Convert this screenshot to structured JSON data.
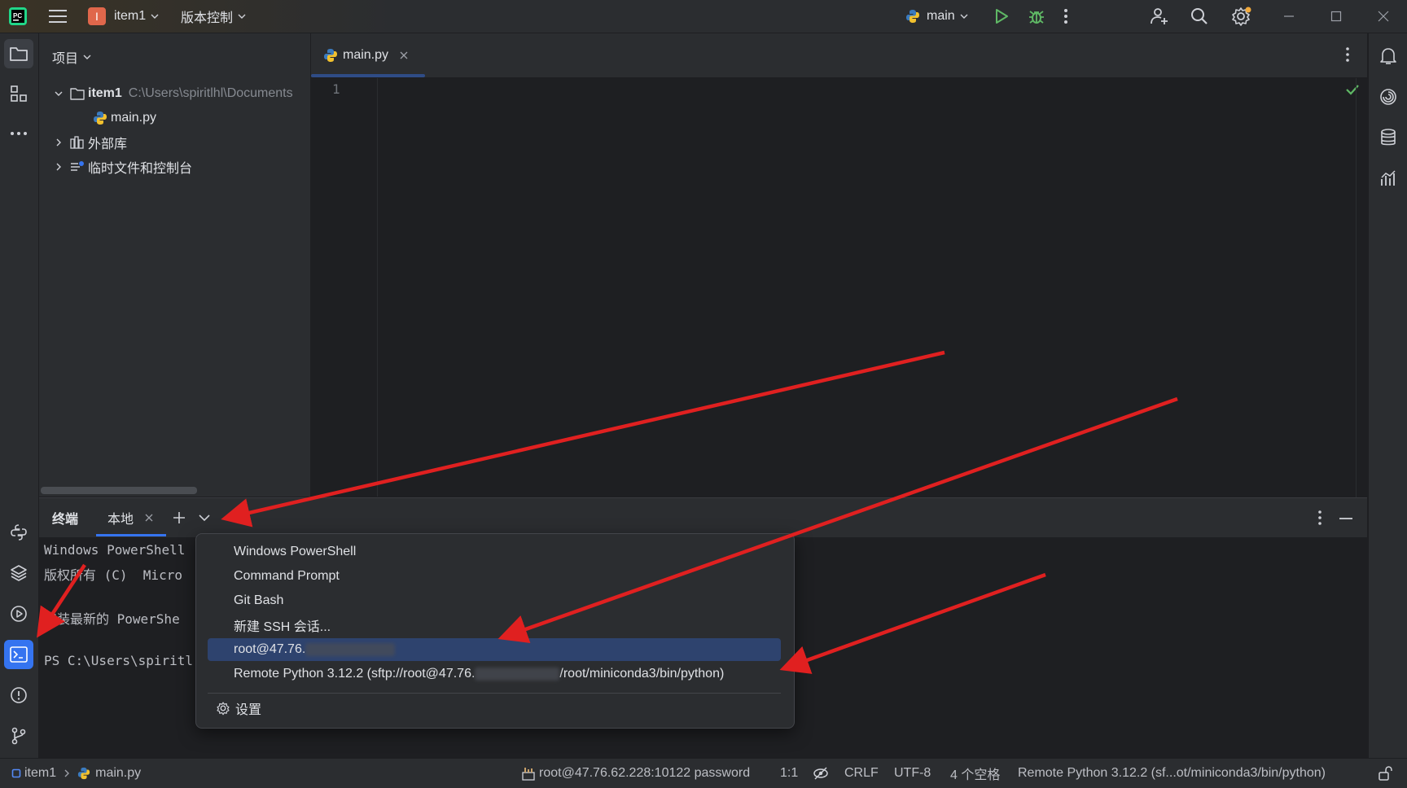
{
  "titlebar": {
    "project_badge": "I",
    "project_name": "item1",
    "vcs_label": "版本控制",
    "run_config": "main",
    "colors": {
      "badge": "#e0674b",
      "run": "#5fb865",
      "debug": "#5fb865"
    }
  },
  "project_panel": {
    "title": "项目",
    "tree": {
      "root_name": "item1",
      "root_path": "C:\\Users\\spiritlhl\\Documents",
      "file": "main.py",
      "external_libs": "外部库",
      "scratches": "临时文件和控制台"
    }
  },
  "editor": {
    "tab_label": "main.py",
    "line_number": "1"
  },
  "terminal": {
    "title": "终端",
    "tab_label": "本地",
    "lines": [
      "Windows PowerShell",
      "版权所有 (C)  Micro",
      "",
      "安装最新的 PowerShe",
      "",
      "PS C:\\Users\\spiritl"
    ]
  },
  "dropdown": {
    "items": [
      "Windows PowerShell",
      "Command Prompt",
      "Git Bash",
      "新建 SSH 会话...",
      "root@47.76.",
      "Remote Python 3.12.2 (sftp://root@47.76."
    ],
    "remote_python_suffix": "/root/miniconda3/bin/python)",
    "settings_label": "设置"
  },
  "statusbar": {
    "breadcrumb_project": "item1",
    "breadcrumb_file": "main.py",
    "ssh": "root@47.76.62.228:10122 password",
    "position": "1:1",
    "line_sep": "CRLF",
    "encoding": "UTF-8",
    "indent": "4 个空格",
    "interpreter": "Remote Python 3.12.2 (sf...ot/miniconda3/bin/python)"
  },
  "annotation_color": "#e02020"
}
